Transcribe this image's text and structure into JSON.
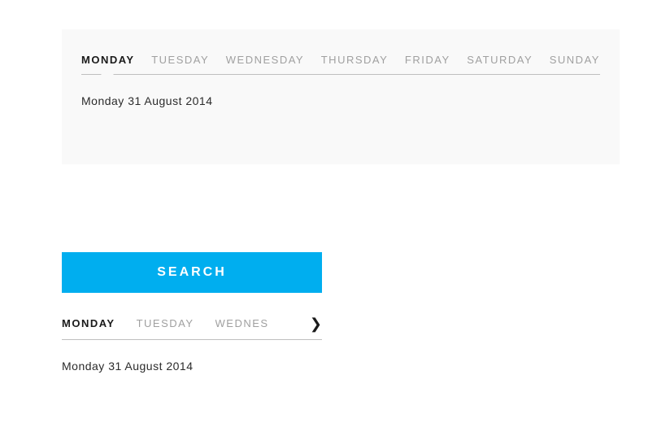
{
  "top": {
    "tabs": [
      {
        "label": "MONDAY",
        "active": true
      },
      {
        "label": "TUESDAY",
        "active": false
      },
      {
        "label": "WEDNESDAY",
        "active": false
      },
      {
        "label": "THURSDAY",
        "active": false
      },
      {
        "label": "FRIDAY",
        "active": false
      },
      {
        "label": "SATURDAY",
        "active": false
      },
      {
        "label": "SUNDAY",
        "active": false
      }
    ],
    "date_text": "Monday 31 August 2014"
  },
  "bottom": {
    "search_label": "SEARCH",
    "tabs": [
      {
        "label": "MONDAY",
        "active": true
      },
      {
        "label": "TUESDAY",
        "active": false
      },
      {
        "label": "WEDNES",
        "active": false,
        "truncated": true
      }
    ],
    "date_text": "Monday 31 August 2014"
  }
}
